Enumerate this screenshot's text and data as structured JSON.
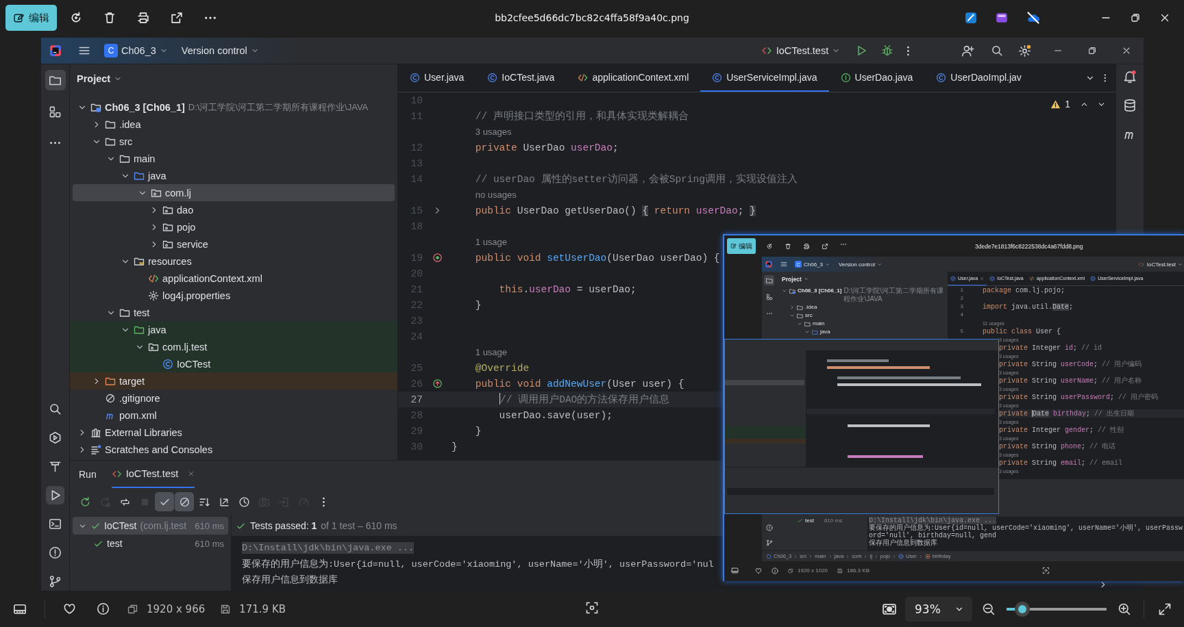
{
  "viewer": {
    "edit_button": "编辑",
    "file_name": "bb2cfee5d66dc7bc82c4ffa58f9a40c.png",
    "dimensions": "1920 x 966",
    "file_size": "171.9 KB",
    "zoom": {
      "value": "93%",
      "level": 0.16
    }
  },
  "ide": {
    "project_badge": "C",
    "project": "Ch06_3",
    "vcs": "Version control",
    "run_config": "IoCTest.test",
    "tool_windows": {
      "top": [
        {
          "kind": "project",
          "selected": true
        },
        {
          "kind": "structure",
          "selected": false
        },
        {
          "kind": "more",
          "selected": false
        }
      ],
      "bottom": [
        {
          "kind": "search",
          "selected": false
        },
        {
          "kind": "services",
          "selected": false
        },
        {
          "kind": "build",
          "selected": false
        },
        {
          "kind": "run",
          "selected": true
        },
        {
          "kind": "terminal",
          "selected": false
        },
        {
          "kind": "problems",
          "selected": false
        },
        {
          "kind": "git",
          "selected": false
        }
      ]
    },
    "project_title": "Project",
    "tree": [
      {
        "label": "Ch06_3 [Ch06_1]",
        "path": "D:\\河工学院\\河工第二学期所有课程作业\\JAVA",
        "kind": "module",
        "expanded": true,
        "selected": false,
        "children": [
          {
            "label": ".idea",
            "kind": "folder",
            "expanded": false,
            "selected": false
          },
          {
            "label": "src",
            "kind": "folder",
            "expanded": true,
            "selected": false,
            "children": [
              {
                "label": "main",
                "kind": "folder",
                "expanded": true,
                "selected": false,
                "children": [
                  {
                    "label": "java",
                    "kind": "source",
                    "expanded": true,
                    "selected": false,
                    "children": [
                      {
                        "label": "com.lj",
                        "kind": "package",
                        "expanded": true,
                        "selected": true,
                        "children": [
                          {
                            "label": "dao",
                            "kind": "package",
                            "expanded": false,
                            "selected": false
                          },
                          {
                            "label": "pojo",
                            "kind": "package",
                            "expanded": false,
                            "selected": false
                          },
                          {
                            "label": "service",
                            "kind": "package",
                            "expanded": false,
                            "selected": false
                          }
                        ]
                      }
                    ]
                  },
                  {
                    "label": "resources",
                    "kind": "resources",
                    "expanded": true,
                    "selected": false,
                    "children": [
                      {
                        "label": "applicationContext.xml",
                        "kind": "xml",
                        "selected": false
                      },
                      {
                        "label": "log4j.properties",
                        "kind": "properties",
                        "selected": false
                      }
                    ]
                  }
                ]
              },
              {
                "label": "test",
                "kind": "folder",
                "expanded": true,
                "selected": false,
                "children": [
                  {
                    "label": "java",
                    "kind": "test-source",
                    "expanded": true,
                    "selected": false,
                    "children": [
                      {
                        "label": "com.lj.test",
                        "kind": "package",
                        "expanded": true,
                        "selected": false,
                        "children": [
                          {
                            "label": "IoCTest",
                            "kind": "class",
                            "selected": false
                          }
                        ]
                      }
                    ]
                  }
                ]
              }
            ]
          },
          {
            "label": "target",
            "kind": "excluded",
            "expanded": false,
            "selected": false
          },
          {
            "label": ".gitignore",
            "kind": "ignore",
            "selected": false
          },
          {
            "label": "pom.xml",
            "kind": "maven",
            "selected": false
          }
        ]
      },
      {
        "label": "External Libraries",
        "kind": "library",
        "expanded": false,
        "selected": false
      },
      {
        "label": "Scratches and Consoles",
        "kind": "scratches",
        "expanded": false,
        "selected": false
      }
    ],
    "tabs": [
      {
        "label": "User.java",
        "kind": "class",
        "selected": false
      },
      {
        "label": "IoCTest.java",
        "kind": "class",
        "selected": false
      },
      {
        "label": "applicationContext.xml",
        "kind": "xml",
        "selected": false
      },
      {
        "label": "UserServiceImpl.java",
        "kind": "class",
        "selected": true
      },
      {
        "label": "UserDao.java",
        "kind": "interface",
        "selected": false
      },
      {
        "label": "UserDaoImpl.jav",
        "kind": "class",
        "selected": false
      }
    ],
    "warnings": "1",
    "code": [
      {
        "kind": "code",
        "number": "10",
        "current": false
      },
      {
        "kind": "code",
        "number": "11",
        "current": false,
        "tokens": [
          {
            "text": "    // 声明接口类型的引用，和具体实现类解耦合",
            "kind": "comment"
          }
        ]
      },
      {
        "kind": "hint",
        "text": "3 usages"
      },
      {
        "kind": "code",
        "number": "12",
        "current": false,
        "tokens": [
          {
            "text": "    private ",
            "kind": "keyword"
          },
          {
            "text": "UserDao ",
            "kind": "plain"
          },
          {
            "text": "userDao",
            "kind": "field"
          },
          {
            "text": ";",
            "kind": "plain"
          }
        ]
      },
      {
        "kind": "code",
        "number": "13",
        "current": false
      },
      {
        "kind": "code",
        "number": "14",
        "current": false,
        "tokens": [
          {
            "text": "    // userDao 属性的setter访问器，会被Spring调用，实现设值注入",
            "kind": "comment"
          }
        ]
      },
      {
        "kind": "hint",
        "text": "no usages"
      },
      {
        "kind": "code",
        "number": "15",
        "current": false,
        "gutter": {
          "kind": "fold"
        },
        "tokens": [
          {
            "text": "    public ",
            "kind": "keyword"
          },
          {
            "text": "UserDao getUserDao() ",
            "kind": "plain"
          },
          {
            "text": "{",
            "kind": "folded"
          },
          {
            "text": " return ",
            "kind": "keyword"
          },
          {
            "text": "userDao",
            "kind": "field"
          },
          {
            "text": "; ",
            "kind": "plain"
          },
          {
            "text": "}",
            "kind": "folded"
          }
        ]
      },
      {
        "kind": "code",
        "number": "18",
        "current": false
      },
      {
        "kind": "hint",
        "text": "1 usage"
      },
      {
        "kind": "code",
        "number": "19",
        "current": false,
        "gutter": {
          "kind": "implementing"
        },
        "tokens": [
          {
            "text": "    public void ",
            "kind": "keyword"
          },
          {
            "text": "setUserDao",
            "kind": "method"
          },
          {
            "text": "(UserDao userDao) {",
            "kind": "plain"
          }
        ]
      },
      {
        "kind": "code",
        "number": "20",
        "current": false
      },
      {
        "kind": "code",
        "number": "21",
        "current": false,
        "tokens": [
          {
            "text": "        this",
            "kind": "keyword"
          },
          {
            "text": ".",
            "kind": "plain"
          },
          {
            "text": "userDao",
            "kind": "field"
          },
          {
            "text": " = userDao;",
            "kind": "plain"
          }
        ]
      },
      {
        "kind": "code",
        "number": "22",
        "current": false,
        "tokens": [
          {
            "text": "    }",
            "kind": "plain"
          }
        ]
      },
      {
        "kind": "code",
        "number": "23",
        "current": false
      },
      {
        "kind": "code",
        "number": "24",
        "current": false
      },
      {
        "kind": "hint",
        "text": "1 usage"
      },
      {
        "kind": "code",
        "number": "25",
        "current": false,
        "tokens": [
          {
            "text": "    @Override",
            "kind": "annotation"
          }
        ]
      },
      {
        "kind": "code",
        "number": "26",
        "current": false,
        "gutter": {
          "kind": "overriding"
        },
        "tokens": [
          {
            "text": "    public void ",
            "kind": "keyword"
          },
          {
            "text": "addNewUser",
            "kind": "method"
          },
          {
            "text": "(User user) {",
            "kind": "plain"
          }
        ]
      },
      {
        "kind": "code",
        "number": "27",
        "current": true,
        "tokens": [
          {
            "text": "        // 调用用户DAO的方法保存用户信息",
            "kind": "comment"
          }
        ]
      },
      {
        "kind": "code",
        "number": "28",
        "current": false,
        "tokens": [
          {
            "text": "        userDao.save(user);",
            "kind": "plain"
          }
        ]
      },
      {
        "kind": "code",
        "number": "29",
        "current": false,
        "tokens": [
          {
            "text": "    }",
            "kind": "plain"
          }
        ]
      },
      {
        "kind": "code",
        "number": "30",
        "current": false,
        "tokens": [
          {
            "text": "}",
            "kind": "plain"
          }
        ]
      }
    ],
    "run": {
      "title": "Run",
      "tab": "IoCTest.test",
      "toolbar": [
        {
          "kind": "rerun",
          "on": false,
          "disabled": false
        },
        {
          "kind": "rerun-failed",
          "on": false,
          "disabled": true
        },
        {
          "kind": "toggle-auto",
          "on": false,
          "disabled": false
        },
        {
          "kind": "stop",
          "on": false,
          "disabled": true
        },
        {
          "kind": "show-passed",
          "on": true,
          "disabled": false
        },
        {
          "kind": "show-ignored",
          "on": true,
          "disabled": false
        },
        {
          "kind": "sort",
          "on": false,
          "disabled": false
        },
        {
          "kind": "collapse",
          "on": false,
          "disabled": false
        },
        {
          "kind": "history",
          "on": false,
          "disabled": false
        },
        {
          "kind": "camera",
          "on": false,
          "disabled": true
        },
        {
          "kind": "import",
          "on": false,
          "disabled": true
        },
        {
          "kind": "gauge",
          "on": false,
          "disabled": true
        },
        {
          "kind": "more",
          "on": false,
          "disabled": false
        }
      ],
      "tests": [
        {
          "name": "IoCTest",
          "package": "(com.lj.test",
          "time": "610 ms",
          "passed": true,
          "selected": true,
          "expanded": true,
          "children": [
            {
              "name": "test",
              "time": "610 ms",
              "passed": true,
              "selected": false
            }
          ]
        }
      ],
      "summary": "Tests passed: **1**",
      "summary_detail": "of 1 test – 610 ms",
      "output": [
        {
          "kind": "command",
          "text": "D:\\Install\\jdk\\bin\\java.exe ..."
        },
        {
          "kind": "stdout",
          "text": "要保存的用户信息为:User{id=null, userCode='xiaoming', userName='小明', userPassword='nul"
        },
        {
          "kind": "stdout",
          "text": "保存用户信息到数据库"
        }
      ]
    }
  },
  "overlay": {
    "edit_button": "编辑",
    "file_name": "3dede7e1813f6c8222538dc4a67fdd8.png",
    "dimensions": "1920 x 1020",
    "file_size": "186.3 KB",
    "ide": {
      "project_badge": "C",
      "project": "Ch06_3",
      "vcs": "Version control",
      "run_config": "IoCTest.test",
      "tool_windows": {
        "top": [
          {
            "kind": "project",
            "selected": true
          },
          {
            "kind": "structure",
            "selected": false
          },
          {
            "kind": "more",
            "selected": false
          }
        ],
        "bottom": [
          {
            "kind": "problems",
            "selected": false
          },
          {
            "kind": "git",
            "selected": false
          }
        ]
      },
      "project_title": "Project",
      "tree": [
        {
          "label": "Ch06_3 [Ch06_1]",
          "path": "D:\\河工学院\\河工第二学期所有课程作业\\JAVA",
          "kind": "module",
          "expanded": true,
          "selected": false,
          "children": [
            {
              "label": ".idea",
              "kind": "folder",
              "expanded": false,
              "selected": false
            },
            {
              "label": "src",
              "kind": "folder",
              "expanded": true,
              "selected": false,
              "children": [
                {
                  "label": "main",
                  "kind": "folder",
                  "expanded": true,
                  "selected": false,
                  "children": [
                    {
                      "label": "java",
                      "kind": "source",
                      "expanded": true,
                      "selected": false
                    }
                  ]
                }
              ]
            }
          ]
        }
      ],
      "tabs": [
        {
          "label": "User.java",
          "kind": "class",
          "selected": true,
          "closable": true
        },
        {
          "label": "IoCTest.java",
          "kind": "class",
          "selected": false
        },
        {
          "label": "applicationContext.xml",
          "kind": "xml",
          "selected": false
        },
        {
          "label": "UserServiceImpl.java",
          "kind": "class",
          "selected": false
        }
      ],
      "code": [
        {
          "kind": "code",
          "number": "1",
          "current": false,
          "tokens": [
            {
              "text": "package ",
              "kind": "keyword"
            },
            {
              "text": "com.lj.pojo;",
              "kind": "plain"
            }
          ]
        },
        {
          "kind": "code",
          "number": "2",
          "current": false
        },
        {
          "kind": "code",
          "number": "3",
          "current": false,
          "tokens": [
            {
              "text": "import ",
              "kind": "keyword"
            },
            {
              "text": "java.util.",
              "kind": "plain"
            },
            {
              "text": "Date",
              "kind": "marked"
            },
            {
              "text": ";",
              "kind": "plain"
            }
          ]
        },
        {
          "kind": "code",
          "number": "4",
          "current": false
        },
        {
          "kind": "hint",
          "text": "11 usages"
        },
        {
          "kind": "code",
          "number": "5",
          "current": false,
          "tokens": [
            {
              "text": "public class ",
              "kind": "keyword"
            },
            {
              "text": "User {",
              "kind": "plain"
            }
          ]
        },
        {
          "kind": "hint",
          "text": "3 usages"
        },
        {
          "kind": "code",
          "current": false,
          "tokens": [
            {
              "text": "    private ",
              "kind": "keyword"
            },
            {
              "text": "Integer ",
              "kind": "plain"
            },
            {
              "text": "id",
              "kind": "field"
            },
            {
              "text": "; ",
              "kind": "plain"
            },
            {
              "text": "// id",
              "kind": "comment"
            }
          ]
        },
        {
          "kind": "hint",
          "text": "3 usages"
        },
        {
          "kind": "code",
          "current": false,
          "tokens": [
            {
              "text": "    private ",
              "kind": "keyword"
            },
            {
              "text": "String ",
              "kind": "plain"
            },
            {
              "text": "userCode",
              "kind": "field"
            },
            {
              "text": "; ",
              "kind": "plain"
            },
            {
              "text": "// 用户编码",
              "kind": "comment"
            }
          ]
        },
        {
          "kind": "hint",
          "text": "3 usages"
        },
        {
          "kind": "code",
          "current": false,
          "tokens": [
            {
              "text": "    private ",
              "kind": "keyword"
            },
            {
              "text": "String ",
              "kind": "plain"
            },
            {
              "text": "userName",
              "kind": "field"
            },
            {
              "text": "; ",
              "kind": "plain"
            },
            {
              "text": "// 用户名称",
              "kind": "comment"
            }
          ]
        },
        {
          "kind": "hint",
          "text": "3 usages"
        },
        {
          "kind": "code",
          "current": false,
          "tokens": [
            {
              "text": "    private ",
              "kind": "keyword"
            },
            {
              "text": "String ",
              "kind": "plain"
            },
            {
              "text": "userPassword",
              "kind": "field"
            },
            {
              "text": "; ",
              "kind": "plain"
            },
            {
              "text": "// 用户密码",
              "kind": "comment"
            }
          ]
        },
        {
          "kind": "hint",
          "text": "3 usages"
        },
        {
          "kind": "code",
          "current": true,
          "tokens": [
            {
              "text": "    private ",
              "kind": "keyword"
            },
            {
              "text": "Date",
              "kind": "marked"
            },
            {
              "text": " birthday",
              "kind": "field"
            },
            {
              "text": "; ",
              "kind": "plain"
            },
            {
              "text": "// 出生日期",
              "kind": "comment"
            }
          ]
        },
        {
          "kind": "hint",
          "text": "3 usages"
        },
        {
          "kind": "code",
          "current": false,
          "tokens": [
            {
              "text": "    private ",
              "kind": "keyword"
            },
            {
              "text": "Integer ",
              "kind": "plain"
            },
            {
              "text": "gender",
              "kind": "field"
            },
            {
              "text": "; ",
              "kind": "plain"
            },
            {
              "text": "// 性别",
              "kind": "comment"
            }
          ]
        },
        {
          "kind": "hint",
          "text": "3 usages"
        },
        {
          "kind": "code",
          "current": false,
          "tokens": [
            {
              "text": "    private ",
              "kind": "keyword"
            },
            {
              "text": "String ",
              "kind": "plain"
            },
            {
              "text": "phone",
              "kind": "field"
            },
            {
              "text": "; ",
              "kind": "plain"
            },
            {
              "text": "// 电话",
              "kind": "comment"
            }
          ]
        },
        {
          "kind": "hint",
          "text": "3 usages"
        },
        {
          "kind": "code",
          "current": false,
          "tokens": [
            {
              "text": "    private ",
              "kind": "keyword"
            },
            {
              "text": "String ",
              "kind": "plain"
            },
            {
              "text": "email",
              "kind": "field"
            },
            {
              "text": "; ",
              "kind": "plain"
            },
            {
              "text": "// email",
              "kind": "comment"
            }
          ]
        },
        {
          "kind": "hint",
          "text": "3 usages"
        }
      ],
      "tests": [
        {
          "name": "test",
          "time": "610 ms",
          "passed": true
        }
      ],
      "output": [
        {
          "kind": "command",
          "text": "D:\\Install\\jdk\\bin\\java.exe ..."
        },
        {
          "kind": "stdout",
          "text": "要保存的用户信息为:User{id=null, userCode='xiaoming', userName='小明', userPassword='null', birthday=null, gend"
        },
        {
          "kind": "stdout",
          "text": "保存用户信息到数据库"
        }
      ],
      "breadcrumbs": [
        {
          "label": "Ch06_3",
          "kind": "module"
        },
        {
          "label": "src",
          "kind": "folder"
        },
        {
          "label": "main",
          "kind": "folder"
        },
        {
          "label": "java",
          "kind": "folder"
        },
        {
          "label": "com",
          "kind": "folder"
        },
        {
          "label": "lj",
          "kind": "folder"
        },
        {
          "label": "pojo",
          "kind": "folder"
        },
        {
          "label": "User",
          "kind": "class"
        },
        {
          "label": "birthday",
          "kind": "field"
        }
      ]
    }
  }
}
